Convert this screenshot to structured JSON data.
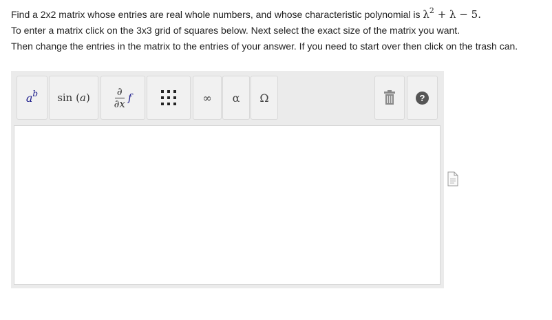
{
  "question": {
    "line1_text": "Find a 2x2 matrix whose entries are real whole numbers, and whose characteristic polynomial is",
    "polynomial": {
      "base": "λ",
      "exponent": "2",
      "rest": "+ λ − 5",
      "end": "."
    },
    "line2": "To enter a matrix click on the 3x3 grid of squares below. Next select the exact size of the matrix you want.",
    "line3": "Then change the entries in the matrix to the entries of your answer. If you need to start over then click on the trash can."
  },
  "toolbar": {
    "superscript": {
      "base": "a",
      "sup": "b"
    },
    "sin": {
      "fn": "sin",
      "open": "(",
      "arg": "a",
      "close": ")"
    },
    "derivative": {
      "num": "∂",
      "den": "∂x",
      "fn": "f"
    },
    "infinity": "∞",
    "alpha": "α",
    "omega": "Ω",
    "help": "?"
  },
  "answer_input": {
    "value": ""
  },
  "colors": {
    "toolbar_bg": "#ebebeb",
    "button_bg": "#f1f1f1",
    "variable": "#1a1a8a"
  },
  "icons": [
    "matrix-grid-icon",
    "trash-icon",
    "help-icon",
    "document-icon"
  ]
}
